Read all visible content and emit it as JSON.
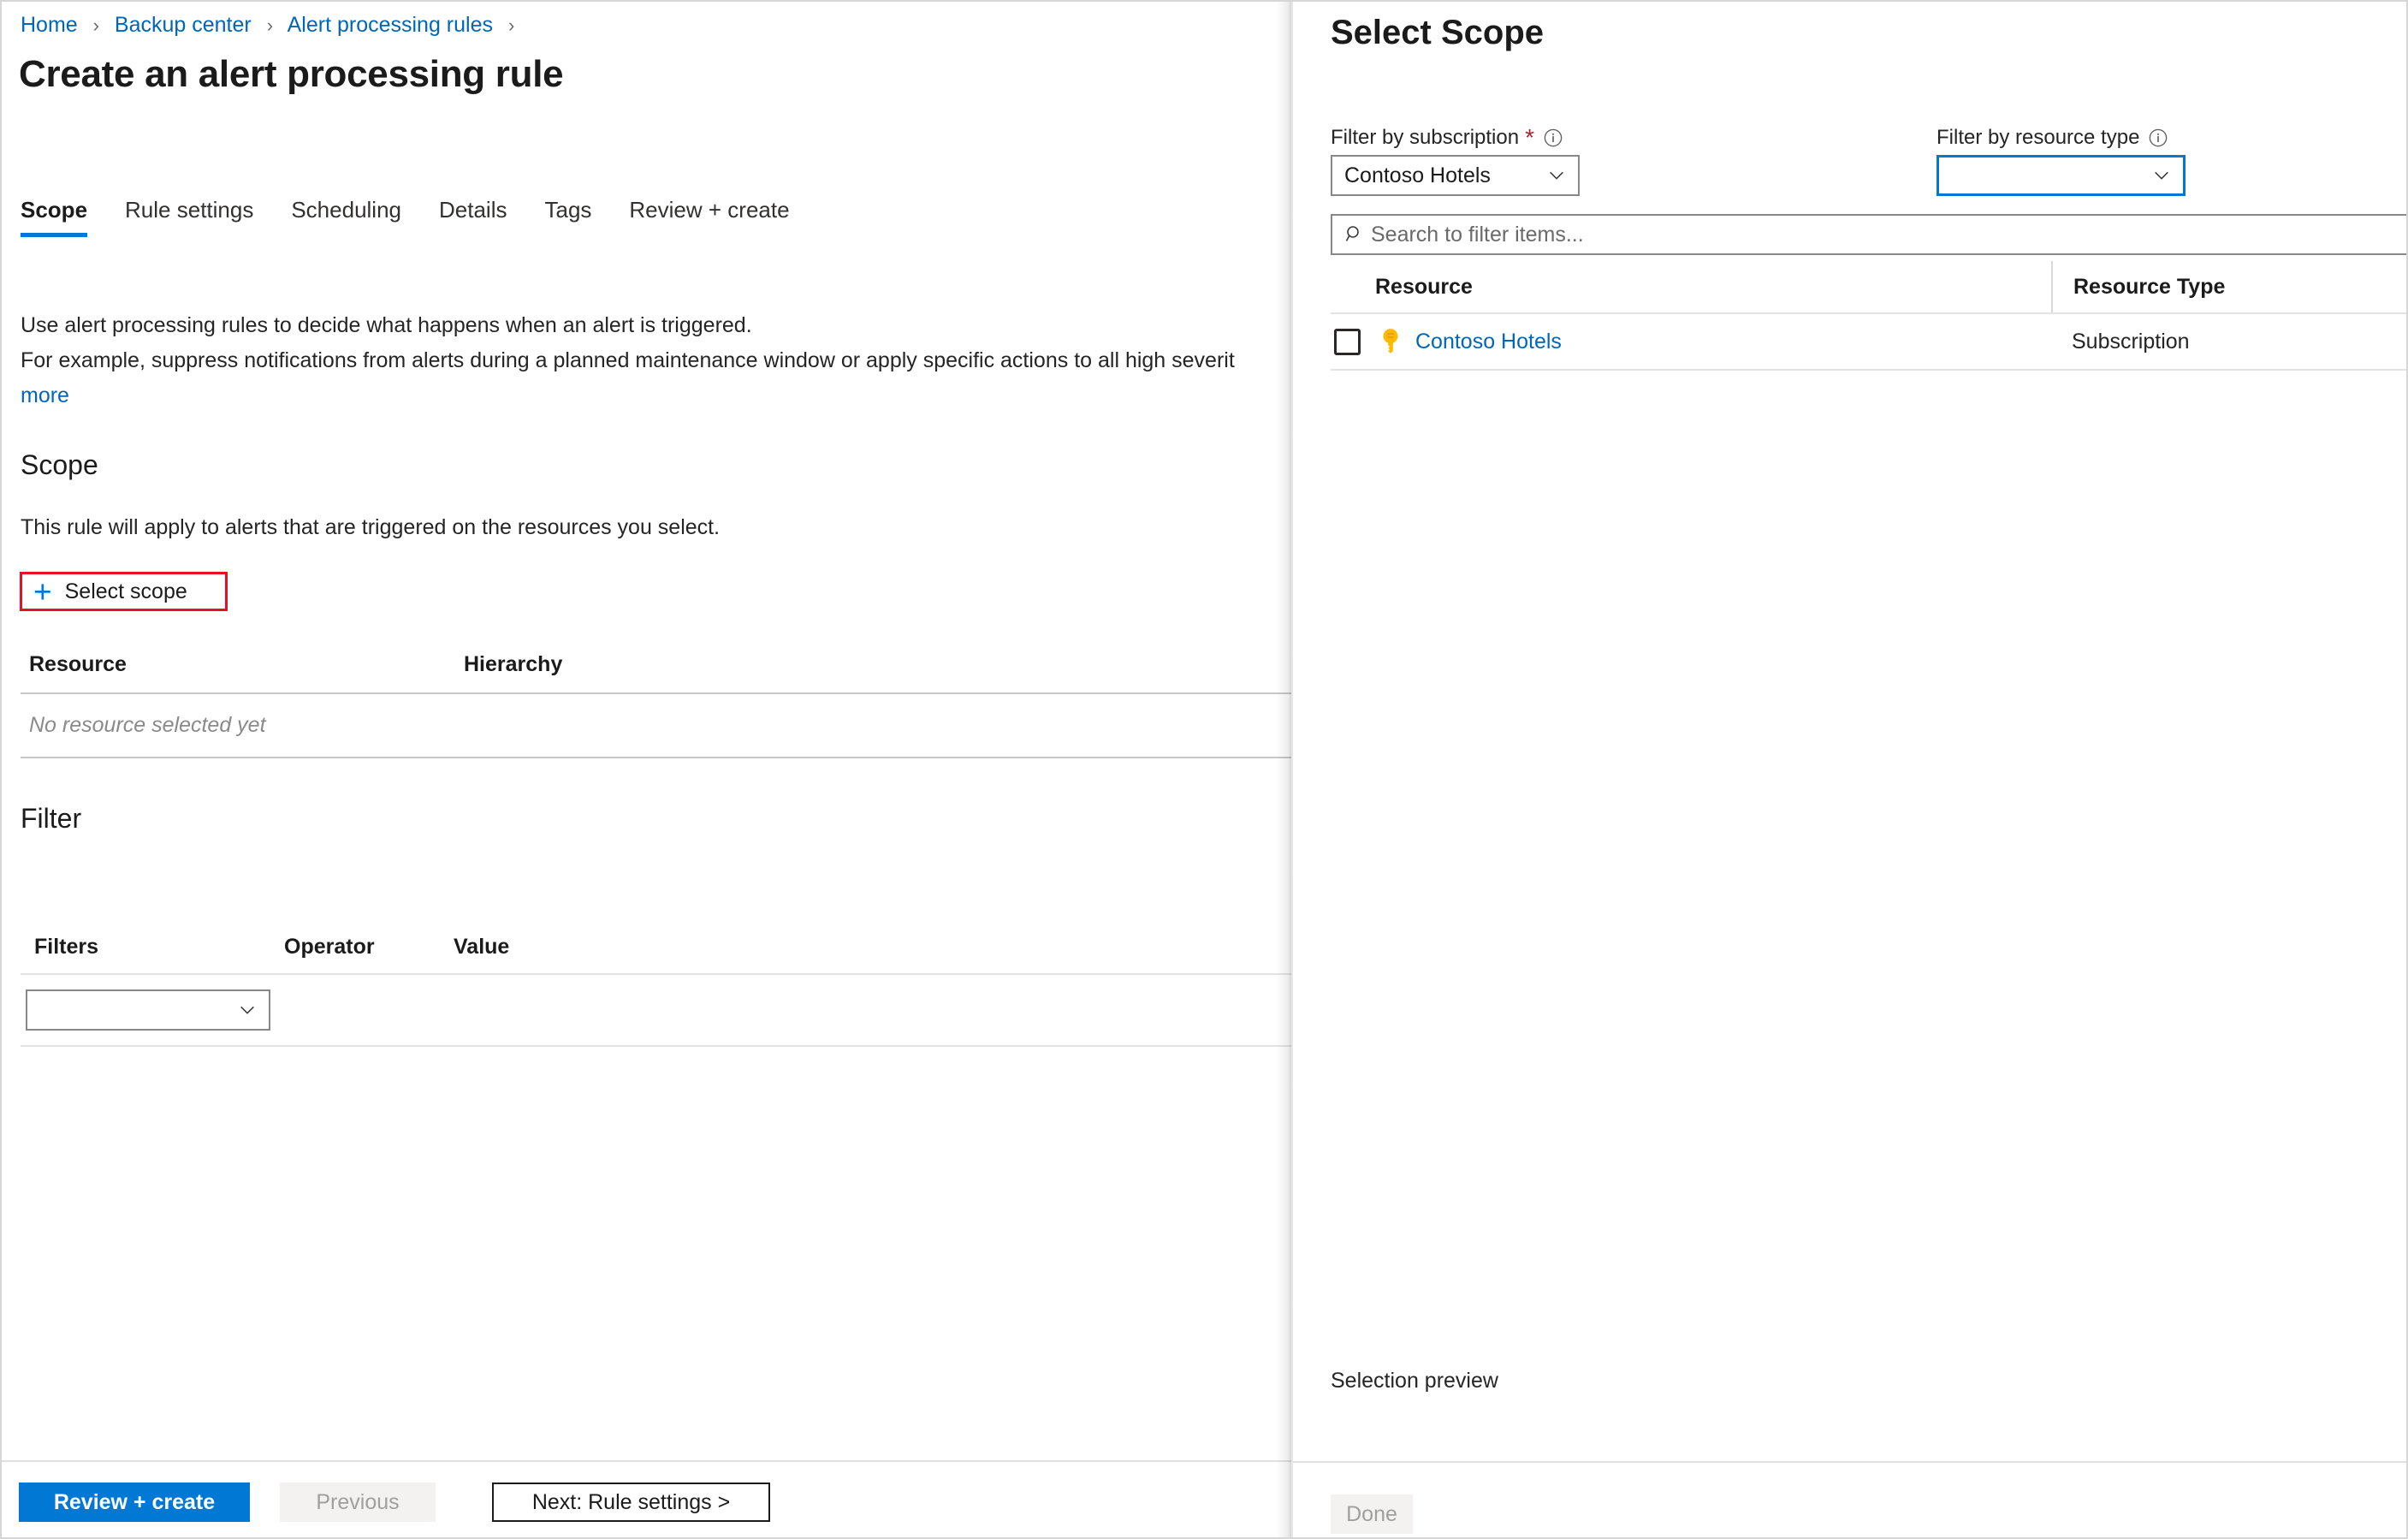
{
  "left_blade": {
    "breadcrumb": [
      {
        "label": "Home"
      },
      {
        "label": "Backup center"
      },
      {
        "label": "Alert processing rules"
      }
    ],
    "page_title": "Create an alert processing rule",
    "tabs": [
      {
        "label": "Scope",
        "active": true
      },
      {
        "label": "Rule settings",
        "active": false
      },
      {
        "label": "Scheduling",
        "active": false
      },
      {
        "label": "Details",
        "active": false
      },
      {
        "label": "Tags",
        "active": false
      },
      {
        "label": "Review + create",
        "active": false
      }
    ],
    "description_line1": "Use alert processing rules to decide what happens when an alert is triggered.",
    "description_line2": "For example, suppress notifications from alerts during a planned maintenance window or apply specific actions to all high severit",
    "description_more": "more",
    "scope": {
      "heading": "Scope",
      "subtitle": "This rule will apply to alerts that are triggered on the resources you select.",
      "select_scope_label": "Select scope",
      "select_scope_icon": "plus-icon",
      "highlight_color": "#e81123",
      "table": {
        "columns": [
          "Resource",
          "Hierarchy"
        ],
        "empty_message": "No resource selected yet"
      }
    },
    "filter": {
      "heading": "Filter",
      "columns": [
        "Filters",
        "Operator",
        "Value"
      ],
      "filter_select_value": ""
    },
    "footer": {
      "review_create": "Review + create",
      "previous": "Previous",
      "next": "Next: Rule settings >"
    }
  },
  "right_panel": {
    "title": "Select Scope",
    "filter_subscription": {
      "label": "Filter by subscription",
      "required": true,
      "info_icon": "info-icon",
      "value": "Contoso Hotels"
    },
    "filter_resource_type": {
      "label": "Filter by resource type",
      "required": false,
      "info_icon": "info-icon",
      "value": "",
      "focused": true
    },
    "search": {
      "icon": "search-icon",
      "placeholder": "Search to filter items..."
    },
    "table": {
      "columns": [
        "Resource",
        "Resource Type"
      ],
      "rows": [
        {
          "checked": false,
          "icon": "key-icon",
          "resource": "Contoso Hotels",
          "resource_type": "Subscription"
        }
      ]
    },
    "selection_preview_label": "Selection preview",
    "done_label": "Done"
  },
  "colors": {
    "accent": "#0078d4",
    "link": "#0067b8",
    "highlight": "#e81123",
    "key_gold": "#ffb900",
    "required_red": "#a4262c"
  }
}
